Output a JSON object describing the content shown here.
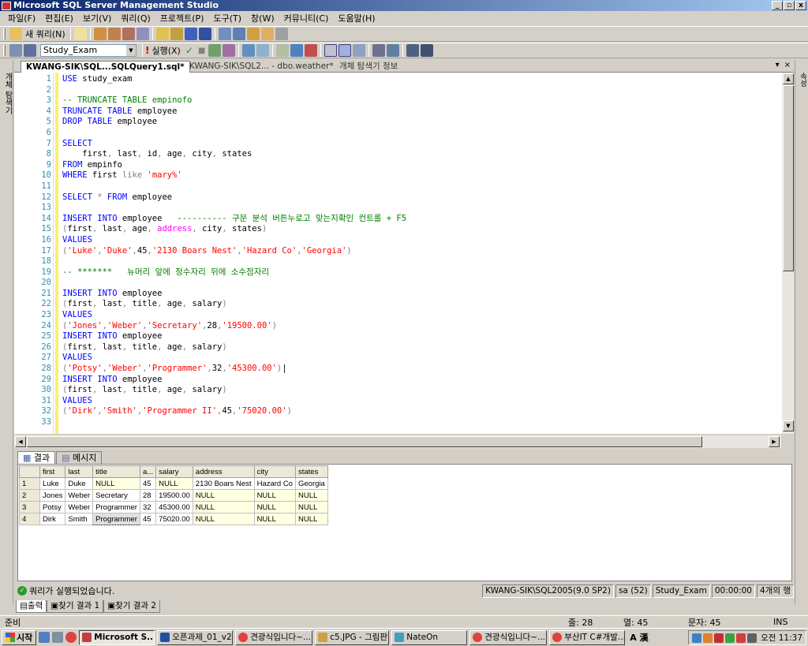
{
  "window": {
    "title": "Microsoft SQL Server Management Studio",
    "min": "_",
    "restore": "▫",
    "close": "x"
  },
  "menu": [
    "파일(F)",
    "편집(E)",
    "보기(V)",
    "쿼리(Q)",
    "프로젝트(P)",
    "도구(T)",
    "창(W)",
    "커뮤니티(C)",
    "도움말(H)"
  ],
  "toolbar1": {
    "new_query": "새 쿼리(N)"
  },
  "toolbar2": {
    "database": "Study_Exam",
    "execute": "실행(X)"
  },
  "left_strip": {
    "label": "개체 탐색기"
  },
  "right_strip": {
    "label": "속성"
  },
  "tabs": [
    {
      "label": "KWANG-SIK\\SQL...SQLQuery1.sql*"
    },
    {
      "label": "KWANG-SIK\\SQL2... - dbo.weather*"
    },
    {
      "label": "개체 탐색기 정보"
    }
  ],
  "tab_controls": {
    "dropdown": "▾",
    "close": "×"
  },
  "editor_lines": [
    {
      "n": "1",
      "t": [
        [
          "kw",
          "USE"
        ],
        [
          "id",
          " study_exam"
        ]
      ]
    },
    {
      "n": "2",
      "t": []
    },
    {
      "n": "3",
      "t": [
        [
          "cm",
          "-- TRUNCATE TABLE empinofo"
        ]
      ]
    },
    {
      "n": "4",
      "t": [
        [
          "kw",
          "TRUNCATE TABLE"
        ],
        [
          "id",
          " employee"
        ]
      ]
    },
    {
      "n": "5",
      "t": [
        [
          "kw",
          "DROP TABLE"
        ],
        [
          "id",
          " employee"
        ]
      ]
    },
    {
      "n": "6",
      "t": []
    },
    {
      "n": "7",
      "t": [
        [
          "kw",
          "SELECT"
        ]
      ]
    },
    {
      "n": "8",
      "t": [
        [
          "id",
          "    first"
        ],
        [
          "gr",
          ","
        ],
        [
          "id",
          " last"
        ],
        [
          "gr",
          ","
        ],
        [
          "id",
          " id"
        ],
        [
          "gr",
          ","
        ],
        [
          "id",
          " age"
        ],
        [
          "gr",
          ","
        ],
        [
          "id",
          " city"
        ],
        [
          "gr",
          ","
        ],
        [
          "id",
          " states"
        ]
      ]
    },
    {
      "n": "9",
      "t": [
        [
          "kw",
          "FROM"
        ],
        [
          "id",
          " empinfo"
        ]
      ]
    },
    {
      "n": "10",
      "t": [
        [
          "kw",
          "WHERE"
        ],
        [
          "id",
          " first "
        ],
        [
          "gr",
          "like"
        ],
        [
          "str",
          " 'mary%'"
        ]
      ]
    },
    {
      "n": "11",
      "t": []
    },
    {
      "n": "12",
      "t": [
        [
          "kw",
          "SELECT"
        ],
        [
          "gr",
          " *"
        ],
        [
          "kw",
          " FROM"
        ],
        [
          "id",
          " employee"
        ]
      ]
    },
    {
      "n": "13",
      "t": []
    },
    {
      "n": "14",
      "t": [
        [
          "kw",
          "INSERT INTO"
        ],
        [
          "id",
          " employee   "
        ],
        [
          "cm",
          "---------- 구문 분석 버튼누로고 맞는지확인 컨트롤 + F5"
        ]
      ]
    },
    {
      "n": "15",
      "t": [
        [
          "gr",
          "("
        ],
        [
          "id",
          "first"
        ],
        [
          "gr",
          ","
        ],
        [
          "id",
          " last"
        ],
        [
          "gr",
          ","
        ],
        [
          "id",
          " age"
        ],
        [
          "gr",
          ","
        ],
        [
          "mg",
          " address"
        ],
        [
          "gr",
          ","
        ],
        [
          "id",
          " city"
        ],
        [
          "gr",
          ","
        ],
        [
          "id",
          " states"
        ],
        [
          "gr",
          ")"
        ]
      ]
    },
    {
      "n": "16",
      "t": [
        [
          "kw",
          "VALUES"
        ]
      ]
    },
    {
      "n": "17",
      "t": [
        [
          "gr",
          "("
        ],
        [
          "str",
          "'Luke'"
        ],
        [
          "gr",
          ","
        ],
        [
          "str",
          "'Duke'"
        ],
        [
          "gr",
          ","
        ],
        [
          "id",
          "45"
        ],
        [
          "gr",
          ","
        ],
        [
          "str",
          "'2130 Boars Nest'"
        ],
        [
          "gr",
          ","
        ],
        [
          "str",
          "'Hazard Co'"
        ],
        [
          "gr",
          ","
        ],
        [
          "str",
          "'Georgia'"
        ],
        [
          "gr",
          ")"
        ]
      ]
    },
    {
      "n": "18",
      "t": []
    },
    {
      "n": "19",
      "t": [
        [
          "cm",
          "-- *******   뉴머리 앞에 정수자리 뒤에 소수점자리"
        ]
      ]
    },
    {
      "n": "20",
      "t": []
    },
    {
      "n": "21",
      "t": [
        [
          "kw",
          "INSERT INTO"
        ],
        [
          "id",
          " employee"
        ]
      ]
    },
    {
      "n": "22",
      "t": [
        [
          "gr",
          "("
        ],
        [
          "id",
          "first"
        ],
        [
          "gr",
          ","
        ],
        [
          "id",
          " last"
        ],
        [
          "gr",
          ","
        ],
        [
          "id",
          " title"
        ],
        [
          "gr",
          ","
        ],
        [
          "id",
          " age"
        ],
        [
          "gr",
          ","
        ],
        [
          "id",
          " salary"
        ],
        [
          "gr",
          ")"
        ]
      ]
    },
    {
      "n": "23",
      "t": [
        [
          "kw",
          "VALUES"
        ]
      ]
    },
    {
      "n": "24",
      "t": [
        [
          "gr",
          "("
        ],
        [
          "str",
          "'Jones'"
        ],
        [
          "gr",
          ","
        ],
        [
          "str",
          "'Weber'"
        ],
        [
          "gr",
          ","
        ],
        [
          "str",
          "'Secretary'"
        ],
        [
          "gr",
          ","
        ],
        [
          "id",
          "28"
        ],
        [
          "gr",
          ","
        ],
        [
          "str",
          "'19500.00'"
        ],
        [
          "gr",
          ")"
        ]
      ]
    },
    {
      "n": "25",
      "t": [
        [
          "kw",
          "INSERT INTO"
        ],
        [
          "id",
          " employee"
        ]
      ]
    },
    {
      "n": "26",
      "t": [
        [
          "gr",
          "("
        ],
        [
          "id",
          "first"
        ],
        [
          "gr",
          ","
        ],
        [
          "id",
          " last"
        ],
        [
          "gr",
          ","
        ],
        [
          "id",
          " title"
        ],
        [
          "gr",
          ","
        ],
        [
          "id",
          " age"
        ],
        [
          "gr",
          ","
        ],
        [
          "id",
          " salary"
        ],
        [
          "gr",
          ")"
        ]
      ]
    },
    {
      "n": "27",
      "t": [
        [
          "kw",
          "VALUES"
        ]
      ]
    },
    {
      "n": "28",
      "t": [
        [
          "gr",
          "("
        ],
        [
          "str",
          "'Potsy'"
        ],
        [
          "gr",
          ","
        ],
        [
          "str",
          "'Weber'"
        ],
        [
          "gr",
          ","
        ],
        [
          "str",
          "'Programmer'"
        ],
        [
          "gr",
          ","
        ],
        [
          "id",
          "32"
        ],
        [
          "gr",
          ","
        ],
        [
          "str",
          "'45300.00'"
        ],
        [
          "gr",
          ")"
        ],
        [
          "id",
          "|"
        ]
      ]
    },
    {
      "n": "29",
      "t": [
        [
          "kw",
          "INSERT INTO"
        ],
        [
          "id",
          " employee"
        ]
      ]
    },
    {
      "n": "30",
      "t": [
        [
          "gr",
          "("
        ],
        [
          "id",
          "first"
        ],
        [
          "gr",
          ","
        ],
        [
          "id",
          " last"
        ],
        [
          "gr",
          ","
        ],
        [
          "id",
          " title"
        ],
        [
          "gr",
          ","
        ],
        [
          "id",
          " age"
        ],
        [
          "gr",
          ","
        ],
        [
          "id",
          " salary"
        ],
        [
          "gr",
          ")"
        ]
      ]
    },
    {
      "n": "31",
      "t": [
        [
          "kw",
          "VALUES"
        ]
      ]
    },
    {
      "n": "32",
      "t": [
        [
          "gr",
          "("
        ],
        [
          "str",
          "'Dirk'"
        ],
        [
          "gr",
          ","
        ],
        [
          "str",
          "'Smith'"
        ],
        [
          "gr",
          ","
        ],
        [
          "str",
          "'Programmer II'"
        ],
        [
          "gr",
          ","
        ],
        [
          "id",
          "45"
        ],
        [
          "gr",
          ","
        ],
        [
          "str",
          "'75020.00'"
        ],
        [
          "gr",
          ")"
        ]
      ]
    },
    {
      "n": "33",
      "t": []
    }
  ],
  "result_tabs": [
    "결과",
    "메시지"
  ],
  "grid": {
    "columns": [
      "first",
      "last",
      "title",
      "a...",
      "salary",
      "address",
      "city",
      "states"
    ],
    "rows": [
      {
        "n": "1",
        "cells": [
          "Luke",
          "Duke",
          "NULL",
          "45",
          "NULL",
          "2130 Boars Nest",
          "Hazard Co",
          "Georgia"
        ]
      },
      {
        "n": "2",
        "cells": [
          "Jones",
          "Weber",
          "Secretary",
          "28",
          "19500.00",
          "NULL",
          "NULL",
          "NULL"
        ]
      },
      {
        "n": "3",
        "cells": [
          "Potsy",
          "Weber",
          "Programmer",
          "32",
          "45300.00",
          "NULL",
          "NULL",
          "NULL"
        ]
      },
      {
        "n": "4",
        "cells": [
          "Dirk",
          "Smith",
          "Programmer",
          "45",
          "75020.00",
          "NULL",
          "NULL",
          "NULL"
        ]
      }
    ]
  },
  "status": {
    "message": "쿼리가 실행되었습니다.",
    "server": "KWANG-SIK\\SQL2005(9.0 SP2)",
    "user": "sa (52)",
    "db": "Study_Exam",
    "time": "00:00:00",
    "rows": "4개의 행"
  },
  "output_tabs": [
    "출력",
    "찾기 결과 1",
    "찾기 결과 2"
  ],
  "app_status": {
    "ready": "준비",
    "line": "줄: 28",
    "col": "열: 45",
    "char": "문자: 45",
    "mode": "INS"
  },
  "taskbar": {
    "start": "시작",
    "buttons": [
      "Microsoft S...",
      "오픈과제_01_v2...",
      "견광식입니다~...",
      "c5.JPG - 그림판",
      "NateOn",
      "견광식입니다~...",
      "부산IT C#개발..."
    ],
    "ime": "A 漢",
    "clock": "오전 11:37"
  }
}
